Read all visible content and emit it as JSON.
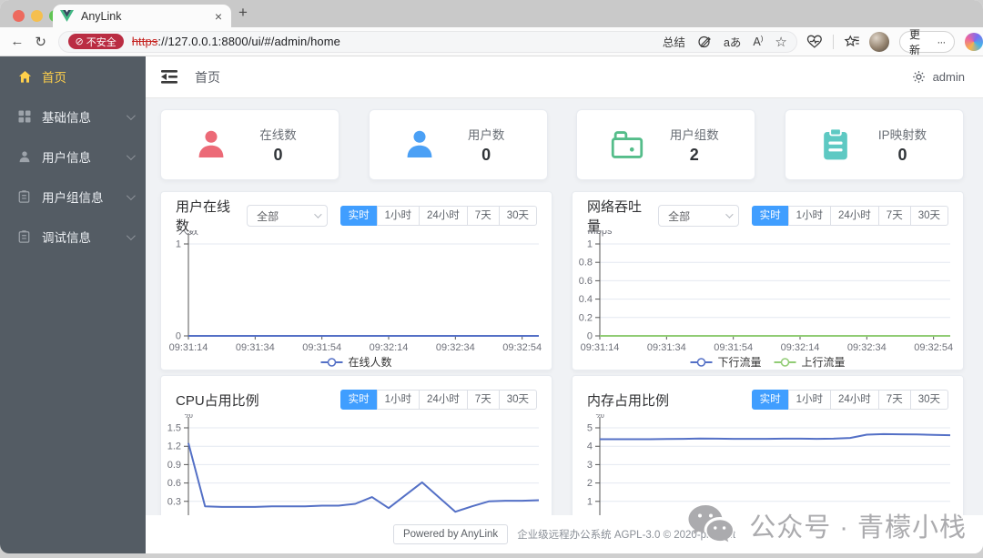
{
  "browser": {
    "tab": {
      "title": "AnyLink"
    },
    "url": {
      "badge": "不安全",
      "scheme": "https",
      "rest": "://127.0.0.1:8800/ui/#/admin/home"
    },
    "actions": {
      "summarize": "总结",
      "translate": "aあ",
      "read_aloud": "A",
      "update": "更新",
      "more": "···"
    },
    "glyphs": {
      "back": "←",
      "reload": "↻",
      "star": "☆",
      "close": "×",
      "newtab": "+",
      "blocked": "⊘"
    }
  },
  "sidebar": {
    "items": [
      {
        "id": "home",
        "label": "首页",
        "active": true,
        "submenu": false
      },
      {
        "id": "base-info",
        "label": "基础信息",
        "active": false,
        "submenu": true
      },
      {
        "id": "user-info",
        "label": "用户信息",
        "active": false,
        "submenu": true
      },
      {
        "id": "group-info",
        "label": "用户组信息",
        "active": false,
        "submenu": true
      },
      {
        "id": "debug-info",
        "label": "调试信息",
        "active": false,
        "submenu": true
      }
    ]
  },
  "header": {
    "breadcrumb": "首页",
    "user": "admin"
  },
  "stats": [
    {
      "label": "在线数",
      "value": "0",
      "icon": "user",
      "color": "#ec6a77"
    },
    {
      "label": "用户数",
      "value": "0",
      "icon": "user",
      "color": "#4ba0f5"
    },
    {
      "label": "用户组数",
      "value": "2",
      "icon": "folder",
      "color": "#55bd8a"
    },
    {
      "label": "IP映射数",
      "value": "0",
      "icon": "clipboard",
      "color": "#5ec9c3"
    }
  ],
  "panels": [
    {
      "title": "用户在线数",
      "select": "全部",
      "has_select": true,
      "ranges": [
        "实时",
        "1小时",
        "24小时",
        "7天",
        "30天"
      ],
      "active_range": 0
    },
    {
      "title": "网络吞吐量",
      "select": "全部",
      "has_select": true,
      "ranges": [
        "实时",
        "1小时",
        "24小时",
        "7天",
        "30天"
      ],
      "active_range": 0
    },
    {
      "title": "CPU占用比例",
      "select": "",
      "has_select": false,
      "ranges": [
        "实时",
        "1小时",
        "24小时",
        "7天",
        "30天"
      ],
      "active_range": 0
    },
    {
      "title": "内存占用比例",
      "select": "",
      "has_select": false,
      "ranges": [
        "实时",
        "1小时",
        "24小时",
        "7天",
        "30天"
      ],
      "active_range": 0
    }
  ],
  "chart_data": [
    {
      "type": "line",
      "title": "用户在线数",
      "ylabel": "人数",
      "ylim": [
        0,
        1
      ],
      "ytick_values": [
        0,
        1
      ],
      "ytick_labels": [
        "0",
        "1"
      ],
      "x_labels": [
        "09:31:14",
        "09:31:34",
        "09:31:54",
        "09:32:14",
        "09:32:34",
        "09:32:54"
      ],
      "x_label_indices": [
        0,
        4,
        8,
        12,
        16,
        20
      ],
      "points": 22,
      "grid": true,
      "legend_visible": true,
      "clipped": false,
      "series": [
        {
          "name": "在线人数",
          "color": "#5470c6",
          "values": [
            0,
            0,
            0,
            0,
            0,
            0,
            0,
            0,
            0,
            0,
            0,
            0,
            0,
            0,
            0,
            0,
            0,
            0,
            0,
            0,
            0,
            0
          ]
        }
      ]
    },
    {
      "type": "line",
      "title": "网络吞吐量",
      "ylabel": "Mbps",
      "ylim": [
        0,
        1
      ],
      "ytick_values": [
        0,
        0.2,
        0.4,
        0.6,
        0.8,
        1
      ],
      "ytick_labels": [
        "0",
        "0.2",
        "0.4",
        "0.6",
        "0.8",
        "1"
      ],
      "x_labels": [
        "09:31:14",
        "09:31:34",
        "09:31:54",
        "09:32:14",
        "09:32:34",
        "09:32:54"
      ],
      "x_label_indices": [
        0,
        4,
        8,
        12,
        16,
        20
      ],
      "points": 22,
      "grid": true,
      "legend_visible": true,
      "clipped": false,
      "series": [
        {
          "name": "下行流量",
          "color": "#5470c6",
          "values": [
            0,
            0,
            0,
            0,
            0,
            0,
            0,
            0,
            0,
            0,
            0,
            0,
            0,
            0,
            0,
            0,
            0,
            0,
            0,
            0,
            0,
            0
          ]
        },
        {
          "name": "上行流量",
          "color": "#91cc75",
          "values": [
            0,
            0,
            0,
            0,
            0,
            0,
            0,
            0,
            0,
            0,
            0,
            0,
            0,
            0,
            0,
            0,
            0,
            0,
            0,
            0,
            0,
            0
          ]
        }
      ]
    },
    {
      "type": "line",
      "title": "CPU占用比例",
      "ylabel": "%",
      "ylim": [
        0,
        1.5
      ],
      "ytick_values": [
        0.3,
        0.6,
        0.9,
        1.2,
        1.5
      ],
      "ytick_labels": [
        "0.3",
        "0.6",
        "0.9",
        "1.2",
        "1.5"
      ],
      "x_labels": [],
      "x_label_indices": [],
      "points": 22,
      "grid": true,
      "legend_visible": false,
      "clipped": true,
      "series": [
        {
          "name": "",
          "color": "#5470c6",
          "values": [
            1.25,
            0.22,
            0.21,
            0.21,
            0.21,
            0.22,
            0.22,
            0.22,
            0.23,
            0.23,
            0.26,
            0.37,
            0.19,
            0.4,
            0.61,
            0.37,
            0.13,
            0.22,
            0.3,
            0.31,
            0.31,
            0.32
          ]
        }
      ]
    },
    {
      "type": "line",
      "title": "内存占用比例",
      "ylabel": "%",
      "ylim": [
        0,
        5
      ],
      "ytick_values": [
        1,
        2,
        3,
        4,
        5
      ],
      "ytick_labels": [
        "1",
        "2",
        "3",
        "4",
        "5"
      ],
      "x_labels": [],
      "x_label_indices": [],
      "points": 22,
      "grid": true,
      "legend_visible": false,
      "clipped": true,
      "series": [
        {
          "name": "",
          "color": "#5470c6",
          "values": [
            4.38,
            4.38,
            4.38,
            4.38,
            4.39,
            4.4,
            4.42,
            4.41,
            4.4,
            4.4,
            4.4,
            4.41,
            4.41,
            4.4,
            4.41,
            4.45,
            4.63,
            4.66,
            4.65,
            4.64,
            4.62,
            4.6
          ]
        }
      ]
    }
  ],
  "footer": {
    "powered": "Powered by AnyLink",
    "info": "企业级远程办公系统 AGPL-3.0 © 2020-present"
  },
  "watermark": {
    "text": "公众号 · 青檬小栈"
  }
}
